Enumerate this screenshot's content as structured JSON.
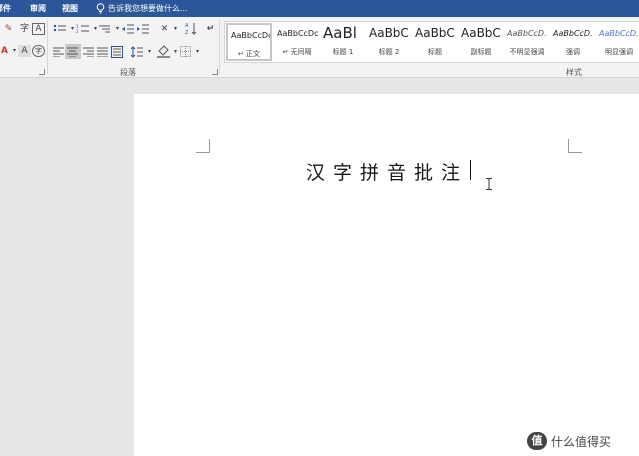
{
  "menu": {
    "tabs": [
      {
        "label": "邮件"
      },
      {
        "label": "审阅"
      },
      {
        "label": "视图"
      }
    ],
    "tell_me": "告诉我您想要做什么..."
  },
  "ribbon": {
    "paragraph_group_label": "段落",
    "styles_group_label": "样式",
    "styles": [
      {
        "sample": "AaBbCcDc",
        "name": "↵ 正文"
      },
      {
        "sample": "AaBbCcDc",
        "name": "↵ 无间隔"
      },
      {
        "sample": "AaBl",
        "name": "标题 1"
      },
      {
        "sample": "AaBbC",
        "name": "标题 2"
      },
      {
        "sample": "AaBbC",
        "name": "标题"
      },
      {
        "sample": "AaBbC",
        "name": "副标题"
      },
      {
        "sample": "AaBbCcD.",
        "name": "不明显强调"
      },
      {
        "sample": "AaBbCcD.",
        "name": "强调"
      },
      {
        "sample": "AaBbCcD.",
        "name": "明显强调"
      }
    ]
  },
  "document": {
    "text": "汉字拼音批注"
  },
  "watermark": {
    "logo": "值",
    "text": "什么值得买"
  },
  "colors": {
    "menubar": "#2b579a",
    "ribbon": "#f3f3f3",
    "workspace": "#e6e6e6",
    "page": "#ffffff"
  }
}
